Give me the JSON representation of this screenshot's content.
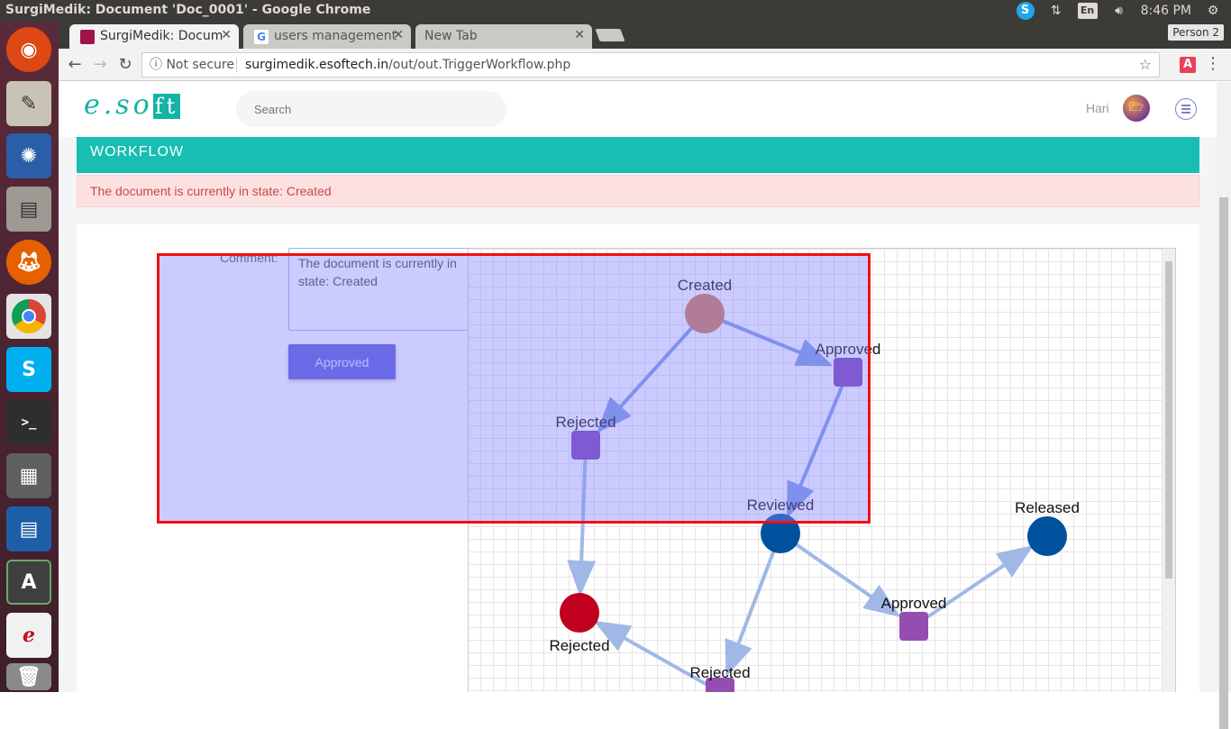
{
  "os": {
    "window_title": "SurgiMedik: Document 'Doc_0001' - Google Chrome",
    "keyboard": "En",
    "time": "8:46 PM"
  },
  "browser": {
    "tabs": [
      {
        "label": "SurgiMedik: Docum",
        "active": true
      },
      {
        "label": "users management",
        "active": false
      },
      {
        "label": "New Tab",
        "active": false
      }
    ],
    "profile": "Person 2",
    "security": "Not secure",
    "url_host": "surgimedik.esoftech.in",
    "url_path": "/out/out.TriggerWorkflow.php"
  },
  "app": {
    "logo_text": "e.so",
    "logo_box": "ft",
    "search_placeholder": "Search",
    "user_name": "Hari"
  },
  "workflow": {
    "heading": "WORKFLOW",
    "alert": "The document is currently in state: Created",
    "comment_label": "Comment:",
    "comment_value": "The document is currently in state: Created",
    "action_button": "Approved"
  },
  "graph": {
    "nodes": [
      {
        "id": "created",
        "label": "Created",
        "shape": "circle",
        "color": "#d2784f"
      },
      {
        "id": "approved1",
        "label": "Approved",
        "shape": "square",
        "color": "#7a3eb3"
      },
      {
        "id": "rejected1",
        "label": "Rejected",
        "shape": "square",
        "color": "#7a3eb3"
      },
      {
        "id": "reviewed",
        "label": "Reviewed",
        "shape": "circle",
        "color": "#00519e"
      },
      {
        "id": "released",
        "label": "Released",
        "shape": "circle",
        "color": "#00519e"
      },
      {
        "id": "rejected_state",
        "label": "Rejected",
        "shape": "circle",
        "color": "#c0001e"
      },
      {
        "id": "approved2",
        "label": "Approved",
        "shape": "square",
        "color": "#944db0"
      },
      {
        "id": "rejected2",
        "label": "Rejected",
        "shape": "square",
        "color": "#944db0"
      }
    ],
    "edges": [
      [
        "created",
        "approved1"
      ],
      [
        "created",
        "rejected1"
      ],
      [
        "approved1",
        "reviewed"
      ],
      [
        "rejected1",
        "rejected_state"
      ],
      [
        "reviewed",
        "approved2"
      ],
      [
        "approved2",
        "released"
      ],
      [
        "reviewed",
        "rejected2"
      ],
      [
        "rejected2",
        "rejected_state"
      ]
    ]
  }
}
